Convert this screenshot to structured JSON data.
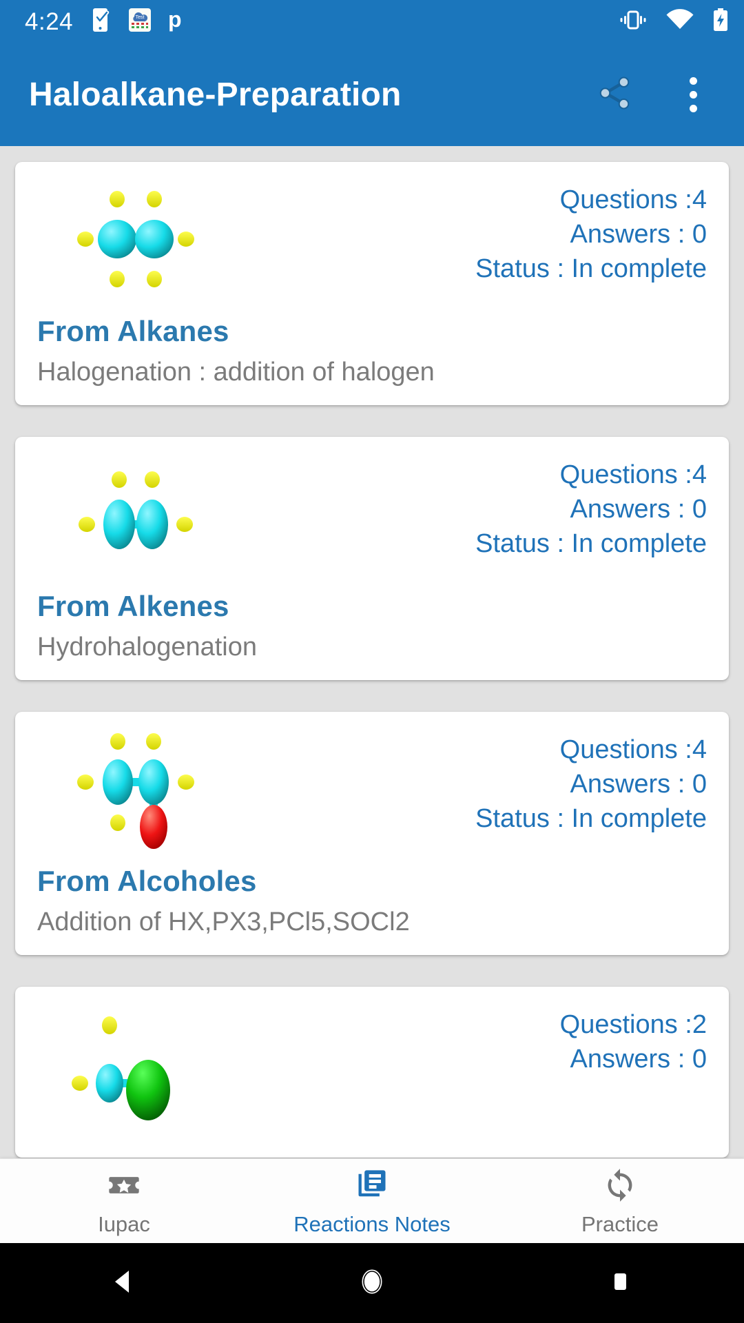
{
  "statusbar": {
    "time": "4:24",
    "left_icons": [
      "phone-check-icon",
      "test-cloud-app-icon",
      "letter-p-app-icon"
    ],
    "right_icons": [
      "vibrate-icon",
      "wifi-icon",
      "battery-charging-icon"
    ],
    "background_color": "#1b76bc"
  },
  "appbar": {
    "title": "Haloalkane-Preparation",
    "share_icon": "share-icon",
    "overflow_icon": "more-vert-icon",
    "background_color": "#1b76bc",
    "title_color": "#ffffff"
  },
  "theme": {
    "accent": "#1f72b8",
    "title_blue": "#2b79ae",
    "subtitle_gray": "#7b7b7b",
    "page_background": "#e1e1e1",
    "card_background": "#ffffff"
  },
  "labels": {
    "questions": "Questions :",
    "answers": "Answers : ",
    "status": "Status : "
  },
  "cards": [
    {
      "molecule": "ethane",
      "questions": "Questions :4",
      "answers": "Answers : 0",
      "status": "Status : In complete",
      "title": "From Alkanes",
      "subtitle": "Halogenation : addition of halogen"
    },
    {
      "molecule": "ethene",
      "questions": "Questions :4",
      "answers": "Answers : 0",
      "status": "Status : In complete",
      "title": "From Alkenes",
      "subtitle": "Hydrohalogenation"
    },
    {
      "molecule": "ethanol",
      "questions": "Questions :4",
      "answers": "Answers : 0",
      "status": "Status : In complete",
      "title": "From Alcoholes",
      "subtitle": "Addition of HX,PX3,PCl5,SOCl2"
    },
    {
      "molecule": "chloromethane",
      "questions": "Questions :2",
      "answers": "Answers : 0",
      "status": "",
      "title": "",
      "subtitle": ""
    }
  ],
  "bottomnav": {
    "items": [
      {
        "label": "Iupac",
        "icon": "ticket-star-icon",
        "selected": false
      },
      {
        "label": "Reactions Notes",
        "icon": "article-notes-icon",
        "selected": true
      },
      {
        "label": "Practice",
        "icon": "sync-refresh-icon",
        "selected": false
      }
    ]
  },
  "sysnav": {
    "back": "back-triangle-icon",
    "home": "home-circle-icon",
    "recents": "recents-square-icon"
  }
}
